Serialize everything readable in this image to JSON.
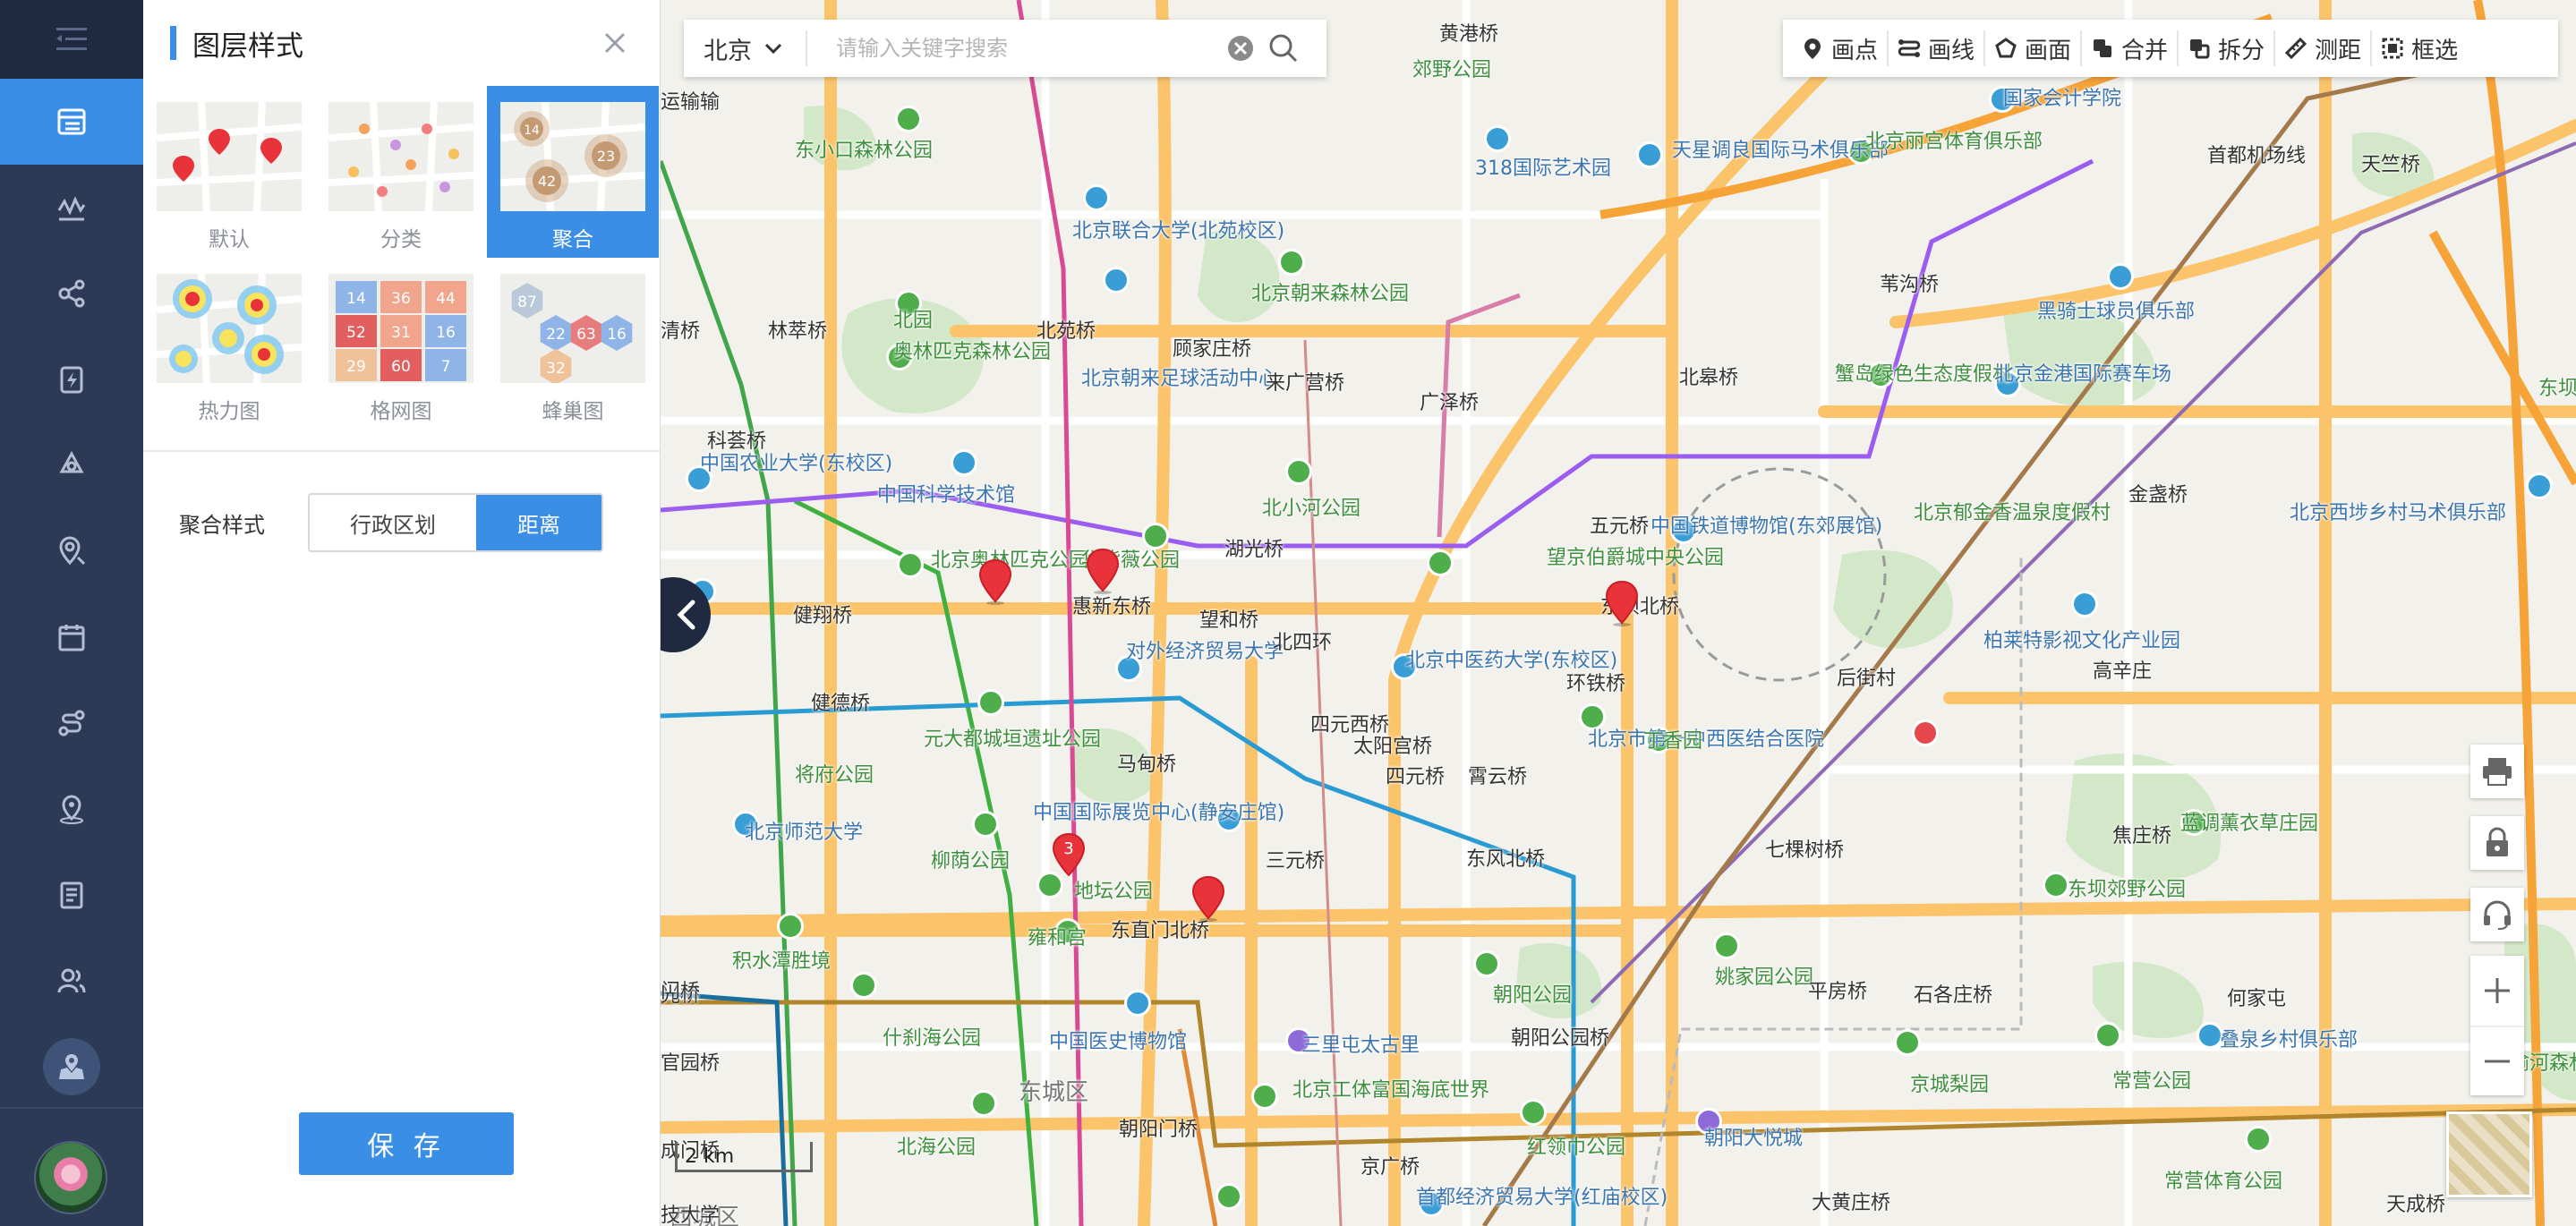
{
  "panel": {
    "title": "图层样式",
    "styles": [
      {
        "label": "默认",
        "selected": false
      },
      {
        "label": "分类",
        "selected": false
      },
      {
        "label": "聚合",
        "selected": true
      },
      {
        "label": "热力图",
        "selected": false
      },
      {
        "label": "格网图",
        "selected": false
      },
      {
        "label": "蜂巢图",
        "selected": false
      }
    ],
    "cluster_preview_numbers": [
      "14",
      "23",
      "42"
    ],
    "grid_preview_numbers": [
      "14",
      "36",
      "44",
      "52",
      "31",
      "16",
      "29",
      "60",
      "7"
    ],
    "hex_preview_numbers": [
      "87",
      "22",
      "63",
      "16",
      "32"
    ],
    "cluster_style_label": "聚合样式",
    "cluster_options": [
      "行政区划",
      "距离"
    ],
    "cluster_selected": "距离",
    "save_label": "保 存"
  },
  "search": {
    "city": "北京",
    "placeholder": "请输入关键字搜索"
  },
  "toolbar": {
    "items": [
      "画点",
      "画线",
      "画面",
      "合并",
      "拆分",
      "测距",
      "框选"
    ]
  },
  "map": {
    "scale_label": "2 km",
    "cluster_marker_count": "3",
    "place_labels": [
      {
        "text": "黄港桥",
        "type": "road"
      },
      {
        "text": "郊野公园",
        "type": "green"
      },
      {
        "text": "国家会计学院",
        "type": "blue"
      },
      {
        "text": "首都机场线",
        "type": "road"
      },
      {
        "text": "天竺桥",
        "type": "road"
      },
      {
        "text": "运输输",
        "type": "road"
      },
      {
        "text": "东小口森林公园",
        "type": "green"
      },
      {
        "text": "318国际艺术园",
        "type": "blue"
      },
      {
        "text": "天星调良国际马术俱乐部",
        "type": "blue"
      },
      {
        "text": "北京丽宫体育俱乐部",
        "type": "green"
      },
      {
        "text": "北京联合大学(北苑校区)",
        "type": "blue"
      },
      {
        "text": "北京朝来森林公园",
        "type": "green"
      },
      {
        "text": "北园",
        "type": "green"
      },
      {
        "text": "苇沟桥",
        "type": "road"
      },
      {
        "text": "黑骑士球员俱乐部",
        "type": "blue"
      },
      {
        "text": "清桥",
        "type": "road"
      },
      {
        "text": "林萃桥",
        "type": "road"
      },
      {
        "text": "北苑桥",
        "type": "road"
      },
      {
        "text": "顾家庄桥",
        "type": "road"
      },
      {
        "text": "奥林匹克森林公园",
        "type": "green"
      },
      {
        "text": "北京朝来足球活动中心",
        "type": "blue"
      },
      {
        "text": "来广营桥",
        "type": "road"
      },
      {
        "text": "广泽桥",
        "type": "road"
      },
      {
        "text": "北皋桥",
        "type": "road"
      },
      {
        "text": "蟹岛绿色生态度假村",
        "type": "green"
      },
      {
        "text": "北京金港国际赛车场",
        "type": "blue"
      },
      {
        "text": "科荟桥",
        "type": "road"
      },
      {
        "text": "中国农业大学(东校区)",
        "type": "blue"
      },
      {
        "text": "中国科学技术馆",
        "type": "blue"
      },
      {
        "text": "北小河公园",
        "type": "green"
      },
      {
        "text": "北京郁金香温泉度假村",
        "type": "green"
      },
      {
        "text": "金盏桥",
        "type": "road"
      },
      {
        "text": "北京西埗乡村马术俱乐部",
        "type": "blue"
      },
      {
        "text": "五元桥",
        "type": "road"
      },
      {
        "text": "中国铁道博物馆(东郊展馆)",
        "type": "blue"
      },
      {
        "text": "北京奥林匹克公园",
        "type": "green"
      },
      {
        "text": "华紫薇公园",
        "type": "green"
      },
      {
        "text": "湖光桥",
        "type": "road"
      },
      {
        "text": "望京伯爵城中央公园",
        "type": "green"
      },
      {
        "text": "健翔桥",
        "type": "road"
      },
      {
        "text": "惠新东桥",
        "type": "road"
      },
      {
        "text": "望和桥",
        "type": "road"
      },
      {
        "text": "东坝北桥",
        "type": "road"
      },
      {
        "text": "柏莱特影视文化产业园",
        "type": "blue"
      },
      {
        "text": "对外经济贸易大学",
        "type": "blue"
      },
      {
        "text": "北四环",
        "type": "road"
      },
      {
        "text": "北京中医药大学(东校区)",
        "type": "blue"
      },
      {
        "text": "环铁桥",
        "type": "road"
      },
      {
        "text": "后街村",
        "type": "road"
      },
      {
        "text": "高辛庄",
        "type": "road"
      },
      {
        "text": "健德桥",
        "type": "road"
      },
      {
        "text": "元大都城垣遗址公园",
        "type": "green"
      },
      {
        "text": "四元西桥",
        "type": "road"
      },
      {
        "text": "北京市第一中西医结合医院",
        "type": "blue"
      },
      {
        "text": "丁香园",
        "type": "green"
      },
      {
        "text": "将府公园",
        "type": "green"
      },
      {
        "text": "马甸桥",
        "type": "road"
      },
      {
        "text": "太阳宫桥",
        "type": "road"
      },
      {
        "text": "四元桥",
        "type": "road"
      },
      {
        "text": "霄云桥",
        "type": "road"
      },
      {
        "text": "北京师范大学",
        "type": "blue"
      },
      {
        "text": "中国国际展览中心(静安庄馆)",
        "type": "blue"
      },
      {
        "text": "柳荫公园",
        "type": "green"
      },
      {
        "text": "地坛公园",
        "type": "green"
      },
      {
        "text": "三元桥",
        "type": "road"
      },
      {
        "text": "东风北桥",
        "type": "road"
      },
      {
        "text": "七棵树桥",
        "type": "road"
      },
      {
        "text": "焦庄桥",
        "type": "road"
      },
      {
        "text": "蓝调薰衣草庄园",
        "type": "green"
      },
      {
        "text": "东坝郊野公园",
        "type": "green"
      },
      {
        "text": "积水潭胜境",
        "type": "green"
      },
      {
        "text": "雍和宫",
        "type": "green"
      },
      {
        "text": "东直门北桥",
        "type": "road"
      },
      {
        "text": "姚家园公园",
        "type": "green"
      },
      {
        "text": "平房桥",
        "type": "road"
      },
      {
        "text": "石各庄桥",
        "type": "road"
      },
      {
        "text": "什刹海公园",
        "type": "green"
      },
      {
        "text": "朝阳公园",
        "type": "green"
      },
      {
        "text": "何家屯",
        "type": "road"
      },
      {
        "text": "中国医史博物馆",
        "type": "blue"
      },
      {
        "text": "三里屯太古里",
        "type": "blue"
      },
      {
        "text": "朝阳公园桥",
        "type": "road"
      },
      {
        "text": "京城梨园",
        "type": "green"
      },
      {
        "text": "常营公园",
        "type": "green"
      },
      {
        "text": "叠泉乡村俱乐部",
        "type": "blue"
      },
      {
        "text": "东城区",
        "type": "district"
      },
      {
        "text": "北京工体富国海底世界",
        "type": "green"
      },
      {
        "text": "北海公园",
        "type": "green"
      },
      {
        "text": "朝阳门桥",
        "type": "road"
      },
      {
        "text": "红领巾公园",
        "type": "green"
      },
      {
        "text": "朝阳大悦城",
        "type": "blue"
      },
      {
        "text": "常营体育公园",
        "type": "green"
      },
      {
        "text": "天成桥",
        "type": "road"
      },
      {
        "text": "京广桥",
        "type": "road"
      },
      {
        "text": "首都经济贸易大学(红庙校区)",
        "type": "blue"
      },
      {
        "text": "大黄庄桥",
        "type": "road"
      },
      {
        "text": "西城区",
        "type": "district"
      },
      {
        "text": "光桥",
        "type": "road"
      },
      {
        "text": "成门桥",
        "type": "road"
      },
      {
        "text": "官园桥",
        "type": "road"
      },
      {
        "text": "门桥",
        "type": "road"
      },
      {
        "text": "物园",
        "type": "road"
      },
      {
        "text": "技大学",
        "type": "road"
      },
      {
        "text": "温榆河森林公园",
        "type": "green"
      },
      {
        "text": "东坝",
        "type": "green"
      }
    ]
  }
}
